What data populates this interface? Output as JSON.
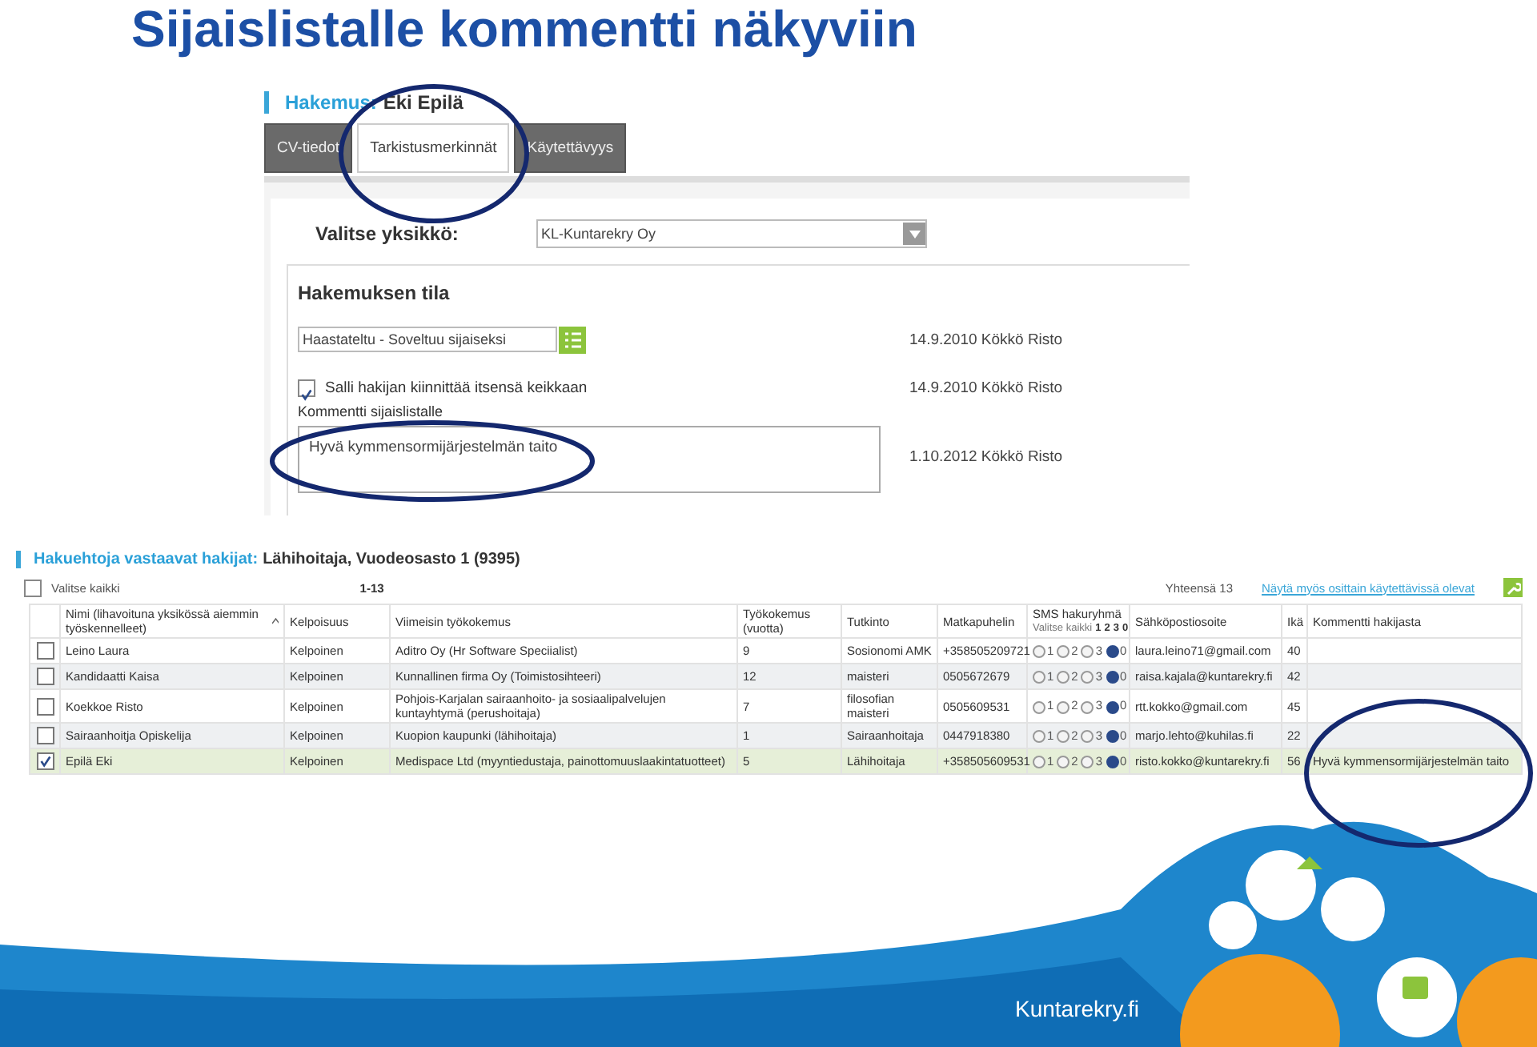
{
  "title": "Sijaislistalle kommentti näkyviin",
  "application": {
    "heading_label": "Hakemus:",
    "heading_name": "Eki Epilä",
    "tabs": [
      {
        "label": "CV-tiedot",
        "selected": false
      },
      {
        "label": "Tarkistusmerkinnät",
        "selected": true
      },
      {
        "label": "Käytettävyys",
        "selected": false
      }
    ],
    "unit_label": "Valitse yksikkö:",
    "unit_value": "KL-Kuntarekry Oy",
    "section_title": "Hakemuksen tila",
    "status": {
      "value": "Haastateltu - Soveltuu sijaiseksi",
      "date": "14.9.2010",
      "person": "Kökkö Risto"
    },
    "self_assign": {
      "label": "Salli hakijan kiinnittää itsensä keikkaan",
      "checked": true,
      "date": "14.9.2010",
      "person": "Kökkö Risto"
    },
    "comment": {
      "label": "Kommentti sijaislistalle",
      "value": "Hyvä kymmensormijärjestelmän taito",
      "date": "1.10.2012",
      "person": "Kökkö Risto"
    }
  },
  "results": {
    "heading_label": "Hakuehtoja vastaavat hakijat:",
    "heading_value": "Lähihoitaja, Vuodeosasto 1 (9395)",
    "select_all": {
      "label": "Valitse kaikki",
      "checked": false
    },
    "range": "1-13",
    "total": "Yhteensä 13",
    "link": "Näytä myös osittain käytettävissä olevat",
    "columns": [
      "Nimi (lihavoituna yksikössä aiemmin työskennelleet)",
      "Kelpoisuus",
      "Viimeisin työkokemus",
      "Työkokemus (vuotta)",
      "Tutkinto",
      "Matkapuhelin",
      "SMS hakuryhmä",
      "Sähköpostiosoite",
      "Ikä",
      "Kommentti hakijasta"
    ],
    "sms_header": {
      "select_all": "Valitse kaikki",
      "options": [
        "1",
        "2",
        "3",
        "0"
      ]
    },
    "rows": [
      {
        "checked": false,
        "selected": false,
        "name": "Leino Laura",
        "qualification": "Kelpoinen",
        "experience": "Aditro Oy (Hr Software Speciialist)",
        "years": "9",
        "degree": "Sosionomi AMK",
        "phone": "+358505209721",
        "sms": [
          {
            "label": "1",
            "selected": false
          },
          {
            "label": "2",
            "selected": false
          },
          {
            "label": "3",
            "selected": false
          },
          {
            "label": "0",
            "selected": true
          }
        ],
        "email": "laura.leino71@gmail.com",
        "age": "40",
        "comment": ""
      },
      {
        "checked": false,
        "selected": false,
        "name": "Kandidaatti Kaisa",
        "qualification": "Kelpoinen",
        "experience": "Kunnallinen firma Oy (Toimistosihteeri)",
        "years": "12",
        "degree": "maisteri",
        "phone": "0505672679",
        "sms": [
          {
            "label": "1",
            "selected": false
          },
          {
            "label": "2",
            "selected": false
          },
          {
            "label": "3",
            "selected": false
          },
          {
            "label": "0",
            "selected": true
          }
        ],
        "email": "raisa.kajala@kuntarekry.fi",
        "age": "42",
        "comment": ""
      },
      {
        "checked": false,
        "selected": false,
        "name": "Koekkoe Risto",
        "qualification": "Kelpoinen",
        "experience": "Pohjois-Karjalan sairaanhoito- ja sosiaalipalvelujen kuntayhtymä (perushoitaja)",
        "years": "7",
        "degree": "filosofian maisteri",
        "phone": "0505609531",
        "sms": [
          {
            "label": "1",
            "selected": false
          },
          {
            "label": "2",
            "selected": false
          },
          {
            "label": "3",
            "selected": false
          },
          {
            "label": "0",
            "selected": true
          }
        ],
        "email": "rtt.kokko@gmail.com",
        "age": "45",
        "comment": ""
      },
      {
        "checked": false,
        "selected": false,
        "name": "Sairaanhoitja  Opiskelija",
        "qualification": "Kelpoinen",
        "experience": "Kuopion kaupunki (lähihoitaja)",
        "years": "1",
        "degree": "Sairaanhoitaja",
        "phone": "0447918380",
        "sms": [
          {
            "label": "1",
            "selected": false
          },
          {
            "label": "2",
            "selected": false
          },
          {
            "label": "3",
            "selected": false
          },
          {
            "label": "0",
            "selected": true
          }
        ],
        "email": "marjo.lehto@kuhilas.fi",
        "age": "22",
        "comment": ""
      },
      {
        "checked": true,
        "selected": true,
        "name": "Epilä Eki",
        "qualification": "Kelpoinen",
        "experience": "Medispace Ltd (myyntiedustaja, painottomuuslaakintatuotteet)",
        "years": "5",
        "degree": "Lähihoitaja",
        "phone": "+358505609531",
        "sms": [
          {
            "label": "1",
            "selected": false
          },
          {
            "label": "2",
            "selected": false
          },
          {
            "label": "3",
            "selected": false
          },
          {
            "label": "0",
            "selected": true
          }
        ],
        "email": "risto.kokko@kuntarekry.fi",
        "age": "56",
        "comment": "Hyvä kymmensormijärjestelmän taito"
      }
    ]
  },
  "footer": {
    "site": "Kuntarekry.fi"
  }
}
